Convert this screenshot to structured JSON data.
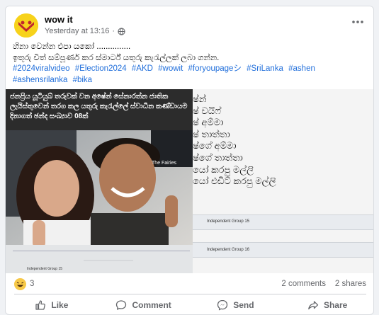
{
  "post": {
    "page_name": "wow it",
    "timestamp": "Yesterday at 13:16",
    "separator": "·",
    "privacy_icon": "globe-icon",
    "line1": "හිනා වෙන්න එපා යකෝ ...............",
    "line2": "ඉතුරු විත් සම්පූර්ණ කර ස්මාර්ට් යතුරු කැරැල්ලක් ලබා ගන්න.",
    "hashtags": [
      "#2024viralvideo",
      "#Election2024",
      "#AKD",
      "#wowit",
      "#foryoupageシ",
      "#SriLanka",
      "#ashen",
      "#ashensrilanka",
      "#bika"
    ]
  },
  "media": {
    "caption": "ජනප්‍රිය යූටියුබ් තරුවක් වන අෂේන් සේනාරත්න ජාතික ලැයිස්තුවෙන් තරග කල යතුරු කැරැල්ලේ ස්වාධීන කණ්ඩායම දිනාගත් ඡන්ද සංඛ්‍යාව 08ක්",
    "watermark": "The Fairies",
    "ballot_label": "Independent Group 15",
    "right_lines": [
      "ෂ්න්",
      "ෂ් වයිෆ්",
      "ෂ් අම්මා",
      "ෂ් තාත්තා",
      "ෂ්ගේ අම්මා",
      "ෂ්ගේ තාත්තා",
      "යෝ කරපු මල්ලි",
      "යෝ එඩිට් කරපු මල්ලි"
    ],
    "right_ballot_1": "Independent Group 15",
    "right_ballot_2": "Independent Group 16"
  },
  "stats": {
    "reaction_icon": "laugh-emoji-icon",
    "reaction_count": "3",
    "comments": "2 comments",
    "shares": "2 shares"
  },
  "actions": {
    "like": "Like",
    "comment": "Comment",
    "send": "Send",
    "share": "Share"
  },
  "colors": {
    "link": "#216fdb",
    "muted": "#65676b",
    "avatar_bg": "#f7d21b"
  }
}
